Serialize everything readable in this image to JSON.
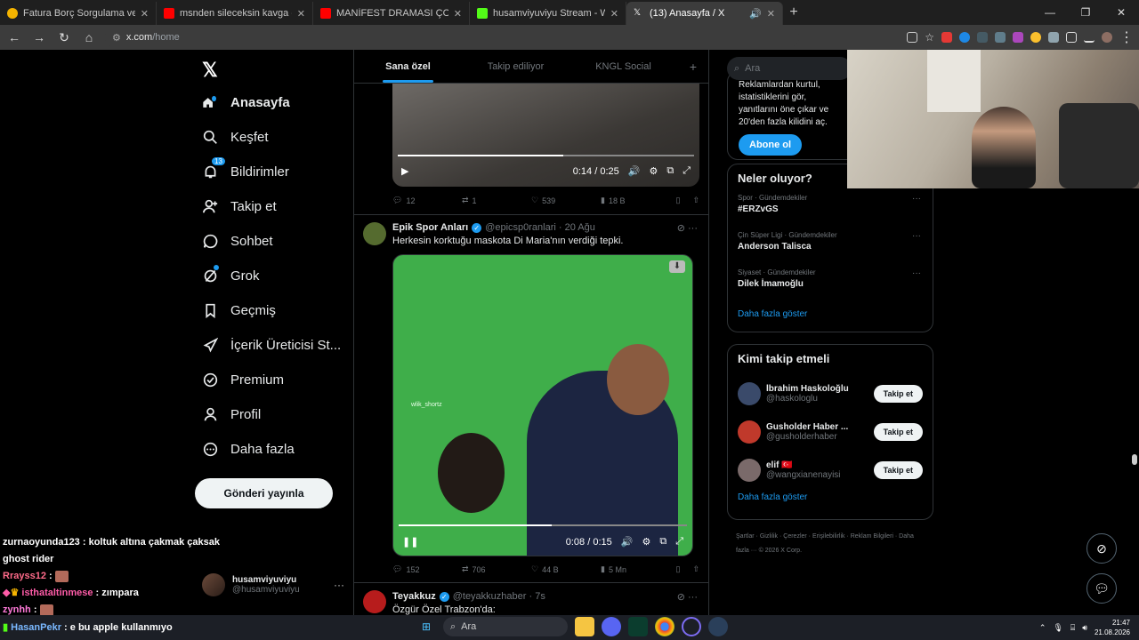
{
  "browser": {
    "tabs": [
      {
        "title": "Fatura Borç Sorgulama ve Öden",
        "color": "#f5b400"
      },
      {
        "title": "msnden sileceksin kavga - YouT",
        "color": "#ff0000"
      },
      {
        "title": "MANİFEST DRAMASI ÇOK FENA",
        "color": "#ff0000"
      },
      {
        "title": "husamviyuviyu Stream - Watch",
        "color": "#53fc18"
      },
      {
        "title": "(13) Anasayfa / X",
        "color": "#ffffff"
      }
    ],
    "new_tab": "+",
    "url_host": "x.com",
    "url_path": "/home"
  },
  "nav": {
    "logo": "𝕏",
    "items": [
      {
        "label": "Anasayfa",
        "icon": "home-icon"
      },
      {
        "label": "Keşfet",
        "icon": "search-icon"
      },
      {
        "label": "Bildirimler",
        "icon": "bell-icon",
        "badge": "13"
      },
      {
        "label": "Takip et",
        "icon": "add-person-icon"
      },
      {
        "label": "Sohbet",
        "icon": "chat-icon"
      },
      {
        "label": "Grok",
        "icon": "grok-icon"
      },
      {
        "label": "Geçmiş",
        "icon": "bookmark-icon"
      },
      {
        "label": "İçerik Üreticisi St...",
        "icon": "rocket-icon"
      },
      {
        "label": "Premium",
        "icon": "verified-icon"
      },
      {
        "label": "Profil",
        "icon": "person-icon"
      },
      {
        "label": "Daha fazla",
        "icon": "more-circle-icon"
      }
    ],
    "post_button": "Gönderi yayınla",
    "account": {
      "name": "husamviyuviyu",
      "handle": "@husamviyuviyu",
      "more": "···"
    }
  },
  "chat": [
    {
      "user": "zurnaoyunda123",
      "msg": " : koltuk altına çakmak çaksak"
    },
    {
      "user": "",
      "msg": "ghost rider"
    },
    {
      "user": "Rrayss12",
      "msg": " : "
    },
    {
      "user": "isthataltinmese",
      "msg": " : zımpara"
    },
    {
      "user": "zynhh",
      "msg": " : "
    }
  ],
  "taskbar_chat": {
    "user": "HasanPekr",
    "msg": " : e bu apple kullanmıyo"
  },
  "feed": {
    "tabs": [
      "Sana özel",
      "Takip ediliyor",
      "KNGL Social"
    ],
    "add_tab": "+",
    "video1": {
      "time": "0:14 / 0:25",
      "progress": 0.56
    },
    "post1_actions": {
      "replies": "12",
      "reposts": "1",
      "likes": "539",
      "views": "18 B"
    },
    "post2": {
      "name": "Epik Spor Anları",
      "handle": "@epicsp0ranlari · 20 Ağu",
      "text": "Herkesin korktuğu maskota Di Maria'nın verdiği tepki.",
      "watermark": "wlik_shortz",
      "time": "0:08 / 0:15",
      "progress": 0.53,
      "replies": "152",
      "reposts": "706",
      "likes": "44 B",
      "views": "5 Mn"
    },
    "post3": {
      "name": "Teyakkuz",
      "handle": "@teyakkuzhaber · 7s",
      "text": "Özgür Özel Trabzon'da:"
    }
  },
  "right": {
    "search_placeholder": "Ara",
    "premium_text": "Reklamlardan kurtul, istatistiklerini gör, yanıtlarını öne çıkar ve 20'den fazla kilidini aç.",
    "subscribe": "Abone ol",
    "trends_title": "Neler oluyor?",
    "trends": [
      {
        "meta": "Spor · Gündemdekiler",
        "topic": "#ERZvGS"
      },
      {
        "meta": "Çin Süper Ligi · Gündemdekiler",
        "topic": "Anderson Talisca"
      },
      {
        "meta": "Siyaset · Gündemdekiler",
        "topic": "Dilek İmamoğlu"
      }
    ],
    "show_more": "Daha fazla göster",
    "who_title": "Kimi takip etmeli",
    "who": [
      {
        "name": "İbrahim Haskoloğlu",
        "handle": "@haskologlu",
        "btn": "Takip et",
        "color": "#3a4a6a"
      },
      {
        "name": "Gusholder Haber ...",
        "handle": "@gusholderhaber",
        "btn": "Takip et",
        "color": "#c0392b"
      },
      {
        "name": "elif 🇹🇷",
        "handle": "@wangxianenayisi",
        "btn": "Takip et",
        "color": "#7a6a6a"
      }
    ],
    "footer": "Şartlar · Gizlilik · Çerezler · Erişilebilirlik · Reklam Bilgileri · Daha fazla ··· © 2026 X Corp."
  },
  "taskbar": {
    "search": "Ara",
    "time": "21:47",
    "date": "21.08.2026"
  }
}
